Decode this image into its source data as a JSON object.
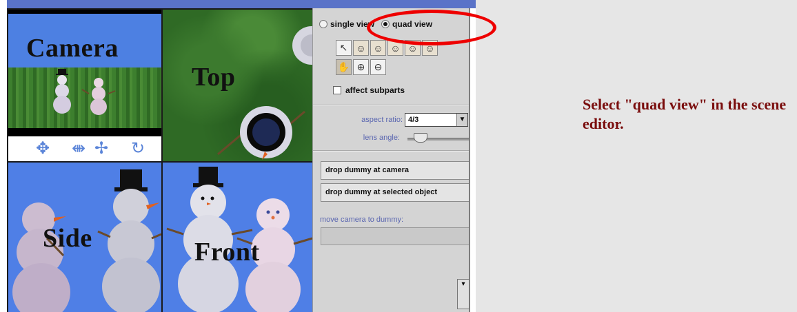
{
  "view_mode": {
    "options": [
      {
        "label": "single view",
        "selected": false
      },
      {
        "label": "quad view",
        "selected": true
      }
    ]
  },
  "panes": {
    "camera": "Camera",
    "top": "Top",
    "side": "Side",
    "front": "Front"
  },
  "tools": {
    "row1": [
      "arrow-pointer-icon",
      "head-icon",
      "head-rotate-icon",
      "head-move-icon",
      "head-resize-icon",
      "head-tilt-icon"
    ],
    "row2": [
      "hand-icon",
      "zoom-in-icon",
      "zoom-out-icon"
    ]
  },
  "affect_subparts": {
    "label": "affect subparts",
    "checked": false
  },
  "camera_props": {
    "aspect_ratio_label": "aspect ratio:",
    "aspect_ratio_value": "4/3",
    "lens_angle_label": "lens angle:"
  },
  "buttons": {
    "drop_at_camera": "drop dummy at camera",
    "drop_at_selected": "drop dummy at selected object"
  },
  "move_camera_label": "move camera to dummy:",
  "instruction": "Select \"quad view\" in the scene editor.",
  "colors": {
    "highlight": "#ee0000",
    "instruction_text": "#7a0d0d",
    "sky": "#4d7fe0",
    "grass": "#2f6a25"
  }
}
